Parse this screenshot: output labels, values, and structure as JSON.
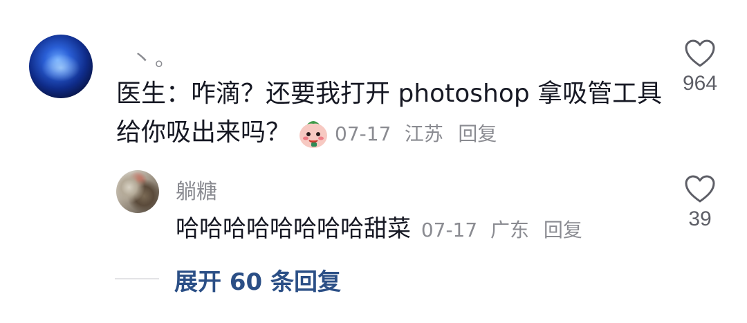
{
  "comment": {
    "nickname": "丶。",
    "text": "医生：咋滴？还要我打开 photoshop 拿吸管工具给你吸出来吗？",
    "date": "07-17",
    "location": "江苏",
    "reply_label": "回复",
    "like_count": "964",
    "emoji_icon": "sticker-emoji"
  },
  "reply": {
    "nickname": "躺糖",
    "text": "哈哈哈哈哈哈哈哈甜菜",
    "date": "07-17",
    "location": "广东",
    "reply_label": "回复",
    "like_count": "39"
  },
  "expand": {
    "label": "展开 60 条回复"
  },
  "colors": {
    "text": "#161823",
    "meta": "#8a8b91",
    "link": "#2b4f86"
  }
}
